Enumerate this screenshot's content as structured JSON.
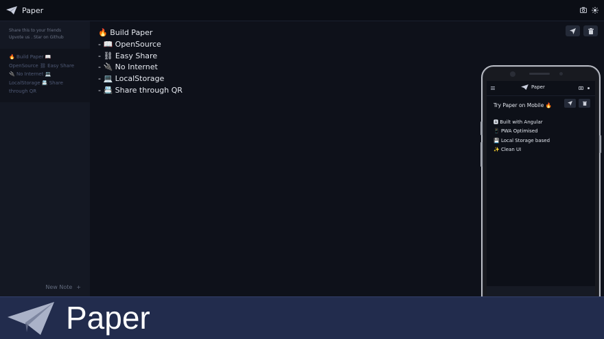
{
  "app": {
    "title": "Paper"
  },
  "topbar": {
    "icons": [
      "camera-icon",
      "sun-icon"
    ]
  },
  "sidebar": {
    "hint_lines": [
      "Share this to your friends",
      "Upvote us . Star on Github"
    ],
    "note_preview_lines": [
      "🔥 Build Paper 📖",
      "OpenSource ⛓ Easy Share",
      "🔌 No Internet 💻",
      "LocalStorage 📇 Share",
      "through QR"
    ],
    "new_note_label": "New Note",
    "new_note_plus": "+"
  },
  "editor": {
    "lines": [
      "🔥 Build Paper",
      "- 📖 OpenSource",
      "- ⛓ Easy Share",
      "- 🔌 No Internet",
      "- 💻 LocalStorage",
      "- 📇 Share through QR"
    ],
    "actions": [
      "send-icon",
      "trash-icon"
    ]
  },
  "mobile": {
    "brand": "Paper",
    "title": "Try Paper on Mobile 🔥",
    "lines": [
      "🅰 Built with Angular",
      "📱 PWA Optimised",
      "💾 Local Storage based",
      "✨ Clean UI"
    ]
  },
  "banner": {
    "title": "Paper"
  },
  "colors": {
    "background": "#0e111a",
    "sidebar": "#141823",
    "banner": "#222c4d",
    "text": "#e6e9f0"
  }
}
